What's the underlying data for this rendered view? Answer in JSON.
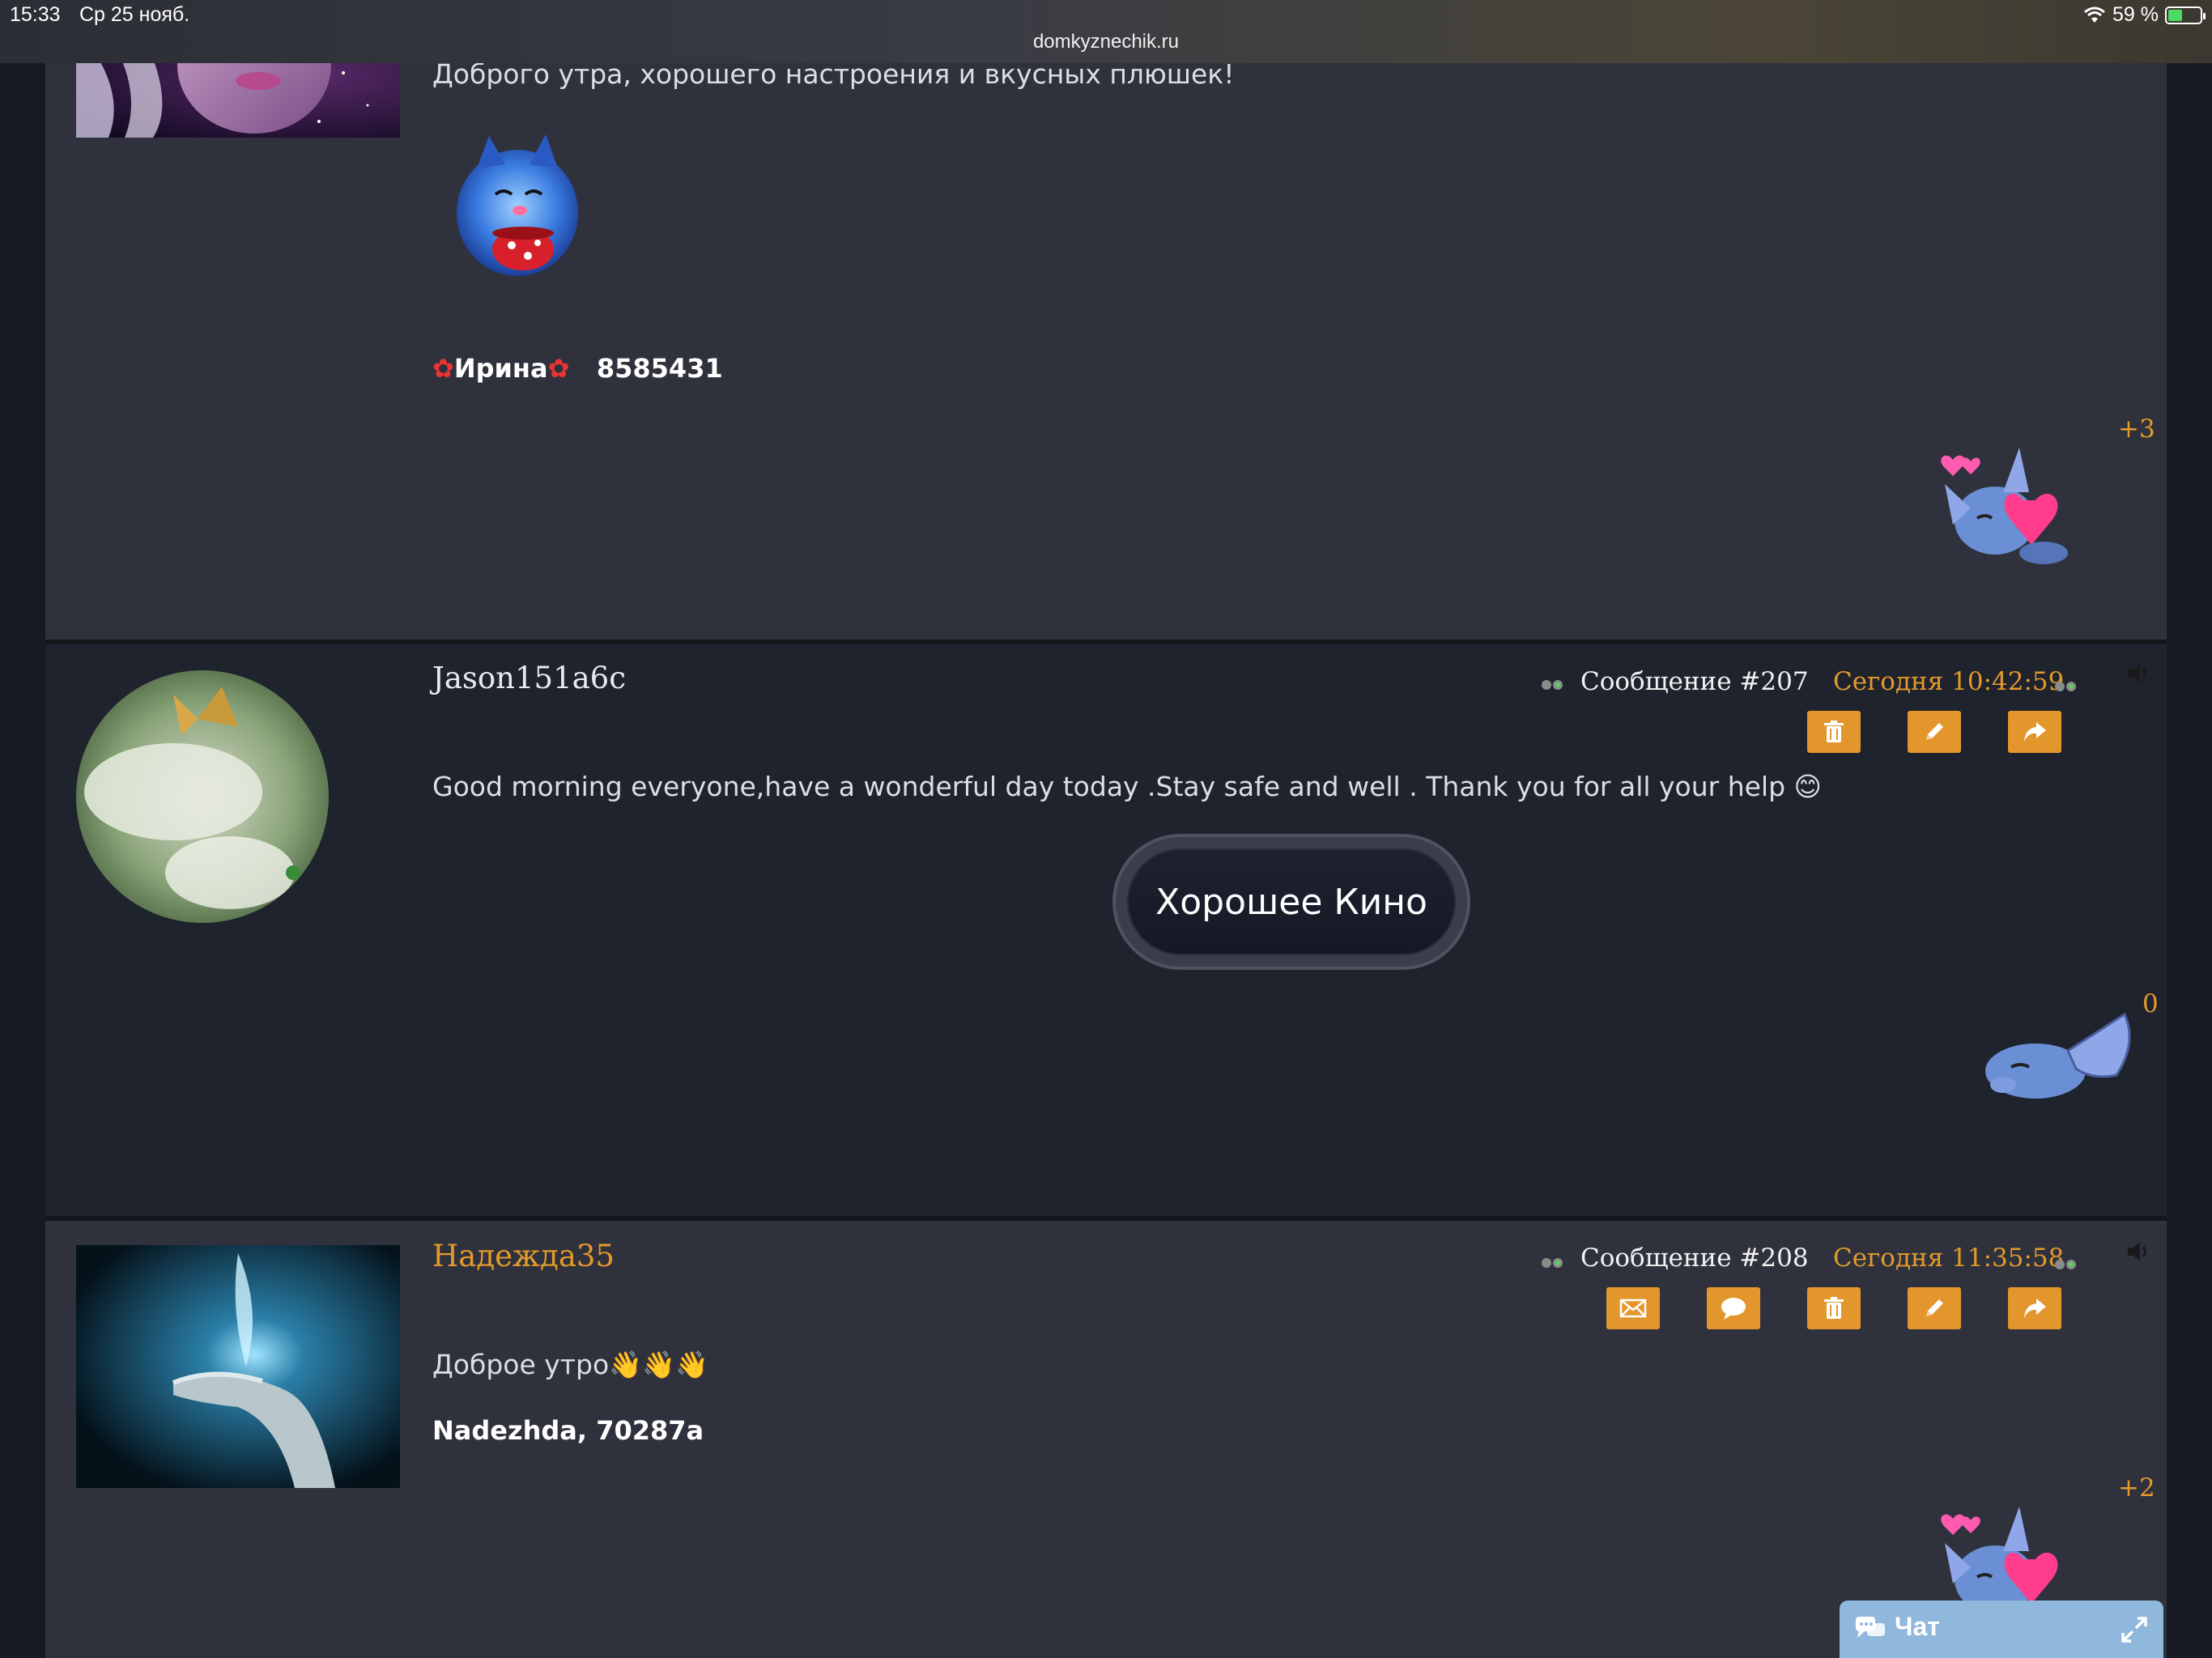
{
  "status_bar": {
    "time": "15:33",
    "date": "Ср 25 нояб.",
    "url": "domkyznechik.ru",
    "battery": "59 %"
  },
  "posts": [
    {
      "text": "Доброго утра, хорошего настроения и вкусных плюшек!",
      "signature_name": "Ирина",
      "signature_code": "8585431",
      "likes": "+3"
    },
    {
      "username": "Jason151a6c",
      "message_label": "Сообщение #207",
      "time": "Сегодня 10:42:59",
      "text": "Good morning everyone,have a wonderful day today .Stay safe and well . Thank you for all your help 😊",
      "button": "Хорошее Кино",
      "likes": "0"
    },
    {
      "username": "Надежда35",
      "message_label": "Сообщение #208",
      "time": "Сегодня 11:35:58",
      "text": "Доброе утро👋👋👋",
      "signature": "Nadezhda, 70287a",
      "likes": "+2"
    }
  ],
  "chat": {
    "label": "Чат"
  },
  "colors": {
    "accent": "#e3962b",
    "username_orange": "#e49a2a",
    "chat": "#8fb8dc"
  }
}
